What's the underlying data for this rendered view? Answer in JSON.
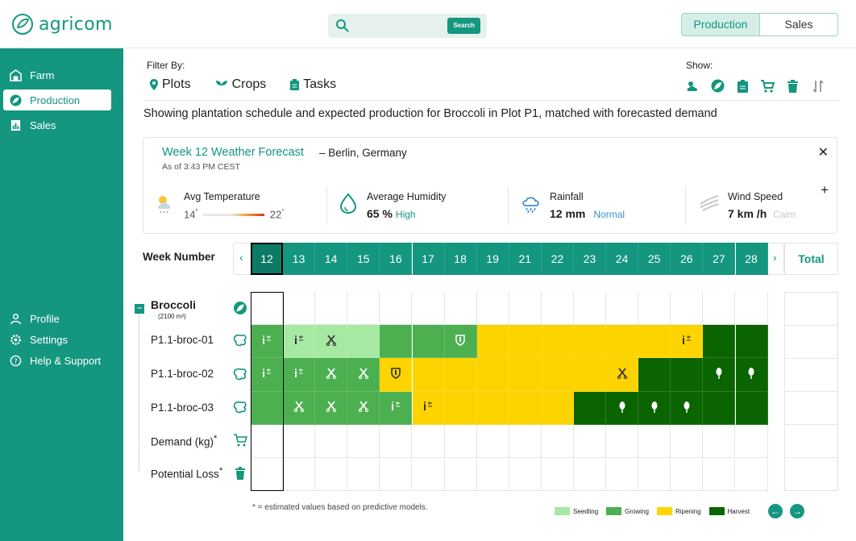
{
  "app": {
    "name": "agricom"
  },
  "search": {
    "button": "Search"
  },
  "mode_toggle": {
    "options": [
      "Production",
      "Sales"
    ],
    "active": "Production"
  },
  "sidebar": {
    "top": [
      {
        "label": "Farm",
        "icon": "barn-icon"
      },
      {
        "label": "Production",
        "icon": "leaf-icon",
        "active": true
      },
      {
        "label": "Sales",
        "icon": "chart-icon"
      }
    ],
    "bottom": [
      {
        "label": "Profile",
        "icon": "user-icon"
      },
      {
        "label": "Settings",
        "icon": "gear-icon"
      },
      {
        "label": "Help & Support",
        "icon": "help-icon"
      }
    ]
  },
  "filters": {
    "label": "Filter By:",
    "items": [
      "Plots",
      "Crops",
      "Tasks"
    ]
  },
  "show": {
    "label": "Show:",
    "icons": [
      "weather-icon",
      "leaf-icon",
      "clipboard-icon",
      "cart-icon",
      "trash-icon",
      "sort-icon"
    ]
  },
  "caption": "Showing plantation schedule and expected production for Broccoli in Plot P1, matched with forecasted demand",
  "weather": {
    "title": "Week 12 Weather Forecast",
    "location": "– Berlin, Germany",
    "as_of": "As of 3:43 PM CEST",
    "temp": {
      "label": "Avg Temperature",
      "min": "14",
      "max": "22",
      "unit": "°"
    },
    "humidity": {
      "label": "Average Humidity",
      "value": "65 %",
      "status": "High"
    },
    "rainfall": {
      "label": "Rainfall",
      "value": "12 mm",
      "status": "Normal"
    },
    "wind": {
      "label": "Wind Speed",
      "value": "7 km /h",
      "status": "Calm"
    }
  },
  "schedule": {
    "week_label": "Week Number",
    "weeks": [
      "12",
      "13",
      "14",
      "15",
      "16",
      "17",
      "18",
      "19",
      "21",
      "22",
      "23",
      "24",
      "25",
      "26",
      "27",
      "28"
    ],
    "selected_week": "12",
    "total_label": "Total",
    "crop": {
      "name": "Broccoli",
      "area": "(2100 m²)"
    },
    "rows": [
      {
        "label": "P1.1-broc-01",
        "cells": [
          "G",
          "S",
          "S",
          "S",
          "G",
          "G",
          "G",
          "R",
          "R",
          "R",
          "R",
          "R",
          "R",
          "R",
          "H",
          "H"
        ],
        "icons": {
          "0": "i",
          "1": "i",
          "2": "x",
          "6": "s",
          "13": "i"
        }
      },
      {
        "label": "P1.1-broc-02",
        "cells": [
          "G",
          "G",
          "G",
          "G",
          "R",
          "R",
          "R",
          "R",
          "R",
          "R",
          "R",
          "R",
          "H",
          "H",
          "H",
          "H"
        ],
        "icons": {
          "0": "i",
          "1": "i",
          "2": "x",
          "3": "x",
          "4": "s",
          "11": "x",
          "14": "b",
          "15": "b"
        }
      },
      {
        "label": "P1.1-broc-03",
        "cells": [
          "G",
          "G",
          "G",
          "G",
          "G",
          "R",
          "R",
          "R",
          "R",
          "R",
          "H",
          "H",
          "H",
          "H",
          "H",
          "H"
        ],
        "icons": {
          "1": "x",
          "2": "x",
          "3": "x",
          "4": "i",
          "5": "i",
          "11": "b",
          "12": "b",
          "13": "b"
        }
      }
    ],
    "demand_label": "Demand (kg)",
    "loss_label": "Potential Loss",
    "asterisk": "*"
  },
  "footnote": "* = estimated values based on predictive models.",
  "legend": [
    {
      "label": "Seedling",
      "color": "#a6e9a2"
    },
    {
      "label": "Growing",
      "color": "#4caf50"
    },
    {
      "label": "Ripening",
      "color": "#fdd400"
    },
    {
      "label": "Harvest",
      "color": "#0a6400"
    }
  ],
  "colors": {
    "S": "#a6e9a2",
    "G": "#4caf50",
    "R": "#fdd400",
    "H": "#0a6400",
    "accent": "#14967f"
  }
}
